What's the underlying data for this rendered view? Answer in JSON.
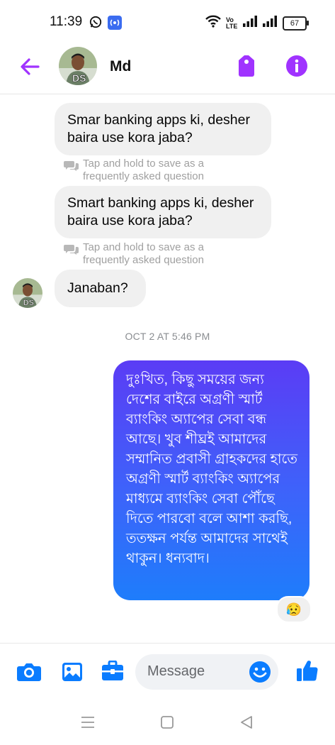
{
  "status_bar": {
    "time": "11:39",
    "network_label": "Vo LTE",
    "battery": "67"
  },
  "header": {
    "contact_name": "Md",
    "avatar_label": "DS",
    "accent_color": "#a033ff"
  },
  "messages": [
    {
      "direction": "incoming",
      "text": "Smar banking apps ki, desher baira use kora jaba?",
      "hint": "Tap and hold to save as a frequently asked question"
    },
    {
      "direction": "incoming",
      "text": "Smart banking apps ki, desher baira use kora jaba?",
      "hint": "Tap and hold to save as a frequently asked question"
    },
    {
      "direction": "incoming",
      "text": "Janaban?"
    }
  ],
  "timestamp": "OCT 2 AT 5:46 PM",
  "reply": {
    "text": "দুঃখিত, কিছু সময়ের জন্য দেশের বাইরে অগ্রণী স্মার্ট ব্যাংকিং অ্যাপের সেবা বন্ধ আছে। খুব শীঘ্রই আমাদের সম্মানিত প্রবাসী গ্রাহকদের হাতে অগ্রণী স্মার্ট ব্যাংকিং অ্যাপের মাধ্যমে ব্যাংকিং সেবা পৌঁছে দিতে পারবো বলে আশা করছি, ততক্ষন পর্যন্ত আমাদের সাথেই থাকুন। ধন্যবাদ।",
    "reaction": "😥",
    "colors": [
      "#5b3cf5",
      "#1e7dfb"
    ]
  },
  "composer": {
    "placeholder": "Message",
    "icons": [
      "camera-icon",
      "gallery-icon",
      "briefcase-icon",
      "emoji-icon",
      "thumbs-up-icon"
    ],
    "icon_color": "#0a7cff"
  },
  "nav_bar": {
    "icons": [
      "menu-icon",
      "home-icon",
      "back-icon"
    ]
  }
}
